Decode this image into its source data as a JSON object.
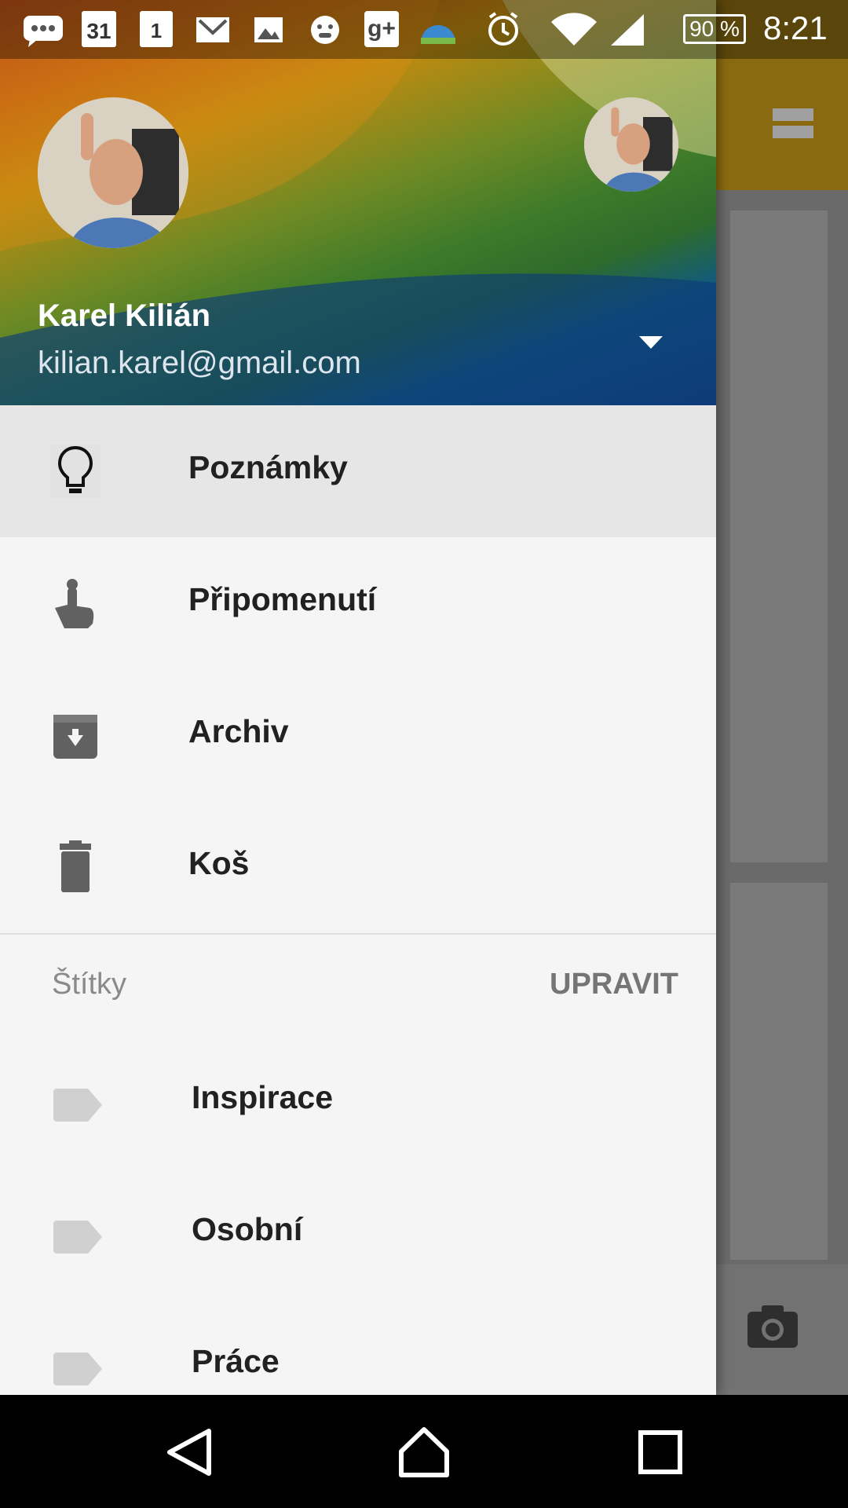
{
  "status_bar": {
    "time": "8:21",
    "battery": "90 %",
    "calendar_day_1": "31",
    "calendar_day_2": "1",
    "icons": [
      "chat-bubble-icon",
      "calendar-icon",
      "calendar-icon",
      "gmail-icon",
      "gallery-icon",
      "app-icon",
      "google-plus-icon",
      "weather-icon",
      "alarm-icon",
      "wifi-icon",
      "signal-icon",
      "battery-icon"
    ]
  },
  "account": {
    "name": "Karel Kilián",
    "email": "kilian.karel@gmail.com"
  },
  "nav": {
    "items": [
      {
        "label": "Poznámky",
        "icon": "lightbulb-icon",
        "active": true
      },
      {
        "label": "Připomenutí",
        "icon": "reminder-finger-icon"
      },
      {
        "label": "Archiv",
        "icon": "archive-icon"
      },
      {
        "label": "Koš",
        "icon": "trash-icon"
      }
    ]
  },
  "labels": {
    "heading": "Štítky",
    "edit": "UPRAVIT",
    "items": [
      {
        "label": "Inspirace",
        "icon": "label-icon"
      },
      {
        "label": "Osobní",
        "icon": "label-icon"
      },
      {
        "label": "Práce",
        "icon": "label-icon"
      }
    ]
  },
  "colors": {
    "drawer_bg": "#f5f5f5",
    "active_item_bg": "#e6e6e6",
    "text_primary": "#212121",
    "text_secondary": "#8a8a8a"
  }
}
